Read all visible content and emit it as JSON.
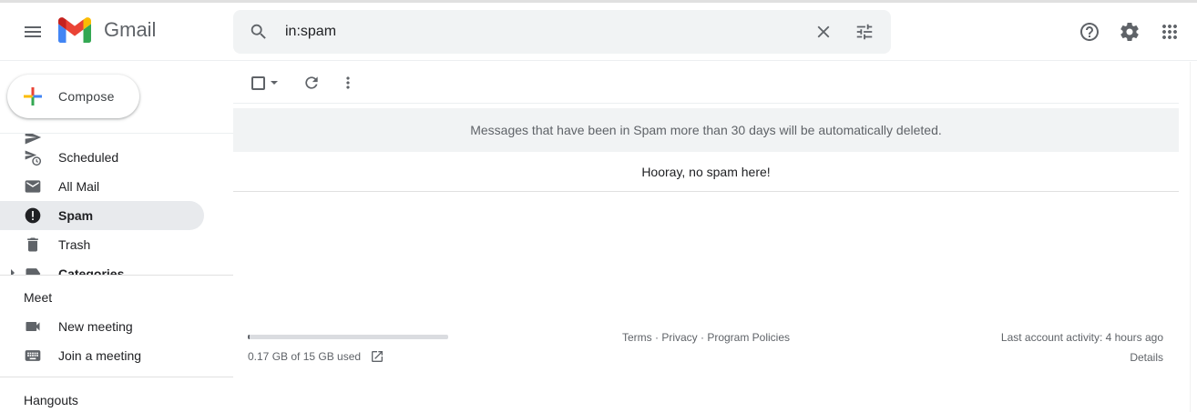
{
  "header": {
    "app_name": "Gmail",
    "search_value": "in:spam",
    "icons": {
      "menu": "menu-icon",
      "search": "search-icon",
      "clear": "close-icon",
      "options": "tune-icon",
      "help": "help-icon",
      "settings": "gear-icon",
      "apps": "apps-grid-icon"
    }
  },
  "compose": {
    "label": "Compose"
  },
  "sidebar": {
    "items": [
      {
        "label": "Scheduled",
        "icon": "scheduled-icon"
      },
      {
        "label": "All Mail",
        "icon": "all-mail-icon"
      },
      {
        "label": "Spam",
        "icon": "spam-icon",
        "active": true
      },
      {
        "label": "Trash",
        "icon": "trash-icon"
      },
      {
        "label": "Categories",
        "icon": "label-icon"
      }
    ]
  },
  "meet": {
    "title": "Meet",
    "items": [
      {
        "label": "New meeting",
        "icon": "video-camera-icon"
      },
      {
        "label": "Join a meeting",
        "icon": "keyboard-icon"
      }
    ]
  },
  "hangouts": {
    "title": "Hangouts"
  },
  "main": {
    "notice": "Messages that have been in Spam more than 30 days will be automatically deleted.",
    "empty_message": "Hooray, no spam here!"
  },
  "footer": {
    "storage_text": "0.17 GB of 15 GB used",
    "storage_fraction": 0.011,
    "terms": "Terms",
    "privacy": "Privacy",
    "program_policies": "Program Policies",
    "separator": " · ",
    "last_activity": "Last account activity: 4 hours ago",
    "details": "Details"
  },
  "colors": {
    "gmail_red": "#EA4335",
    "gmail_blue": "#4285F4",
    "gmail_green": "#34A853",
    "gmail_yellow": "#FBBC04",
    "active_bg": "#e8eaed",
    "search_bg": "#f1f3f4"
  }
}
